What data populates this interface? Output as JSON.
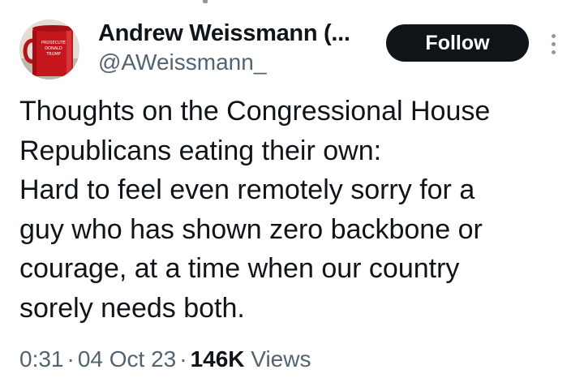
{
  "author": {
    "display_name": "Andrew Weissmann (...",
    "handle": "@AWeissmann_",
    "avatar_mug_text": "PROSECUTE DONALD TRUMP"
  },
  "actions": {
    "follow_label": "Follow",
    "more_icon": "more-vertical-icon"
  },
  "tweet": {
    "lines": [
      "Thoughts on the Congressional House",
      "Republicans eating their own:",
      "Hard to feel even remotely sorry for a",
      "guy who has shown zero backbone or",
      "courage, at a time when our country",
      "sorely needs both."
    ]
  },
  "meta": {
    "time": "0:31",
    "date": "04 Oct 23",
    "separator": "·",
    "views_count": "146K",
    "views_label": "Views"
  },
  "colors": {
    "text_primary": "#0f1419",
    "text_secondary": "#536471",
    "follow_bg": "#0f1419",
    "follow_text": "#ffffff",
    "mug_red": "#c4161c"
  }
}
